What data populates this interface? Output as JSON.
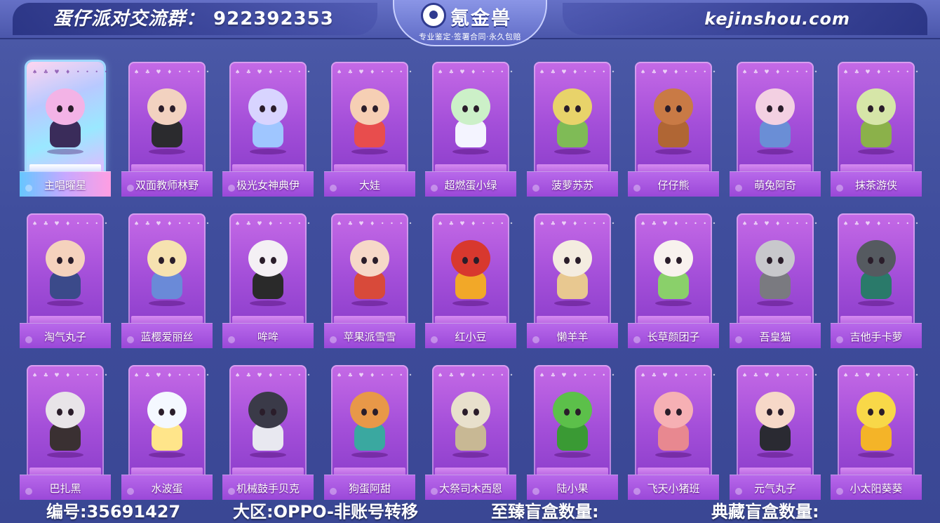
{
  "header": {
    "group_label": "蛋仔派对交流群：",
    "group_number": "922392353",
    "brand_name": "氪金兽",
    "brand_tagline": "专业鉴定·签署合同·永久包赔",
    "site_url": "kejinshou.com"
  },
  "suits_text": "♠ ♣ ♥ ♦ • • • •",
  "skins": [
    {
      "name": "主唱曜星",
      "special": true,
      "colors": [
        "#f3b3e6",
        "#3a2c5a"
      ]
    },
    {
      "name": "双面教师林野",
      "colors": [
        "#f2d2c0",
        "#2b2b2e"
      ]
    },
    {
      "name": "极光女神典伊",
      "colors": [
        "#d8d4ff",
        "#9fc6ff"
      ]
    },
    {
      "name": "大娃",
      "colors": [
        "#f6cfb4",
        "#e84d4d"
      ]
    },
    {
      "name": "超燃蛋小绿",
      "colors": [
        "#ccf0c8",
        "#f4f4ff"
      ]
    },
    {
      "name": "菠萝苏苏",
      "colors": [
        "#e8d36a",
        "#7fbb56"
      ]
    },
    {
      "name": "仔仔熊",
      "colors": [
        "#c97a45",
        "#b06634"
      ]
    },
    {
      "name": "萌兔阿奇",
      "colors": [
        "#f3d0e2",
        "#6a8ed6"
      ]
    },
    {
      "name": "抹茶游侠",
      "colors": [
        "#d6e6a8",
        "#8bb14a"
      ]
    },
    {
      "name": "淘气丸子",
      "colors": [
        "#f5d2bd",
        "#3b4a8a"
      ]
    },
    {
      "name": "蓝樱爱丽丝",
      "colors": [
        "#f6e2b0",
        "#6a8ad8"
      ]
    },
    {
      "name": "哞哞",
      "colors": [
        "#f4f0f4",
        "#2a2a2a"
      ]
    },
    {
      "name": "苹果派雪雪",
      "colors": [
        "#f6d8c8",
        "#d84a3a"
      ]
    },
    {
      "name": "红小豆",
      "colors": [
        "#d8382e",
        "#f2a828"
      ]
    },
    {
      "name": "懒羊羊",
      "colors": [
        "#f4ece0",
        "#e8c890"
      ]
    },
    {
      "name": "长草颜团子",
      "colors": [
        "#f8f2ee",
        "#8ad06a"
      ]
    },
    {
      "name": "吾皇猫",
      "colors": [
        "#c8c8cc",
        "#7a7a80"
      ]
    },
    {
      "name": "吉他手卡萝",
      "colors": [
        "#555a60",
        "#2a7a6a"
      ]
    },
    {
      "name": "巴扎黑",
      "colors": [
        "#e8e4e8",
        "#3a3032"
      ]
    },
    {
      "name": "水波蛋",
      "colors": [
        "#f4f8ff",
        "#ffe58a"
      ]
    },
    {
      "name": "机械鼓手贝克",
      "colors": [
        "#3a3a48",
        "#e8e8f0"
      ]
    },
    {
      "name": "狗蛋阿甜",
      "colors": [
        "#e89848",
        "#3aa8a0"
      ]
    },
    {
      "name": "大祭司木西恩",
      "colors": [
        "#e8e0cc",
        "#c8b894"
      ]
    },
    {
      "name": "陆小果",
      "colors": [
        "#5cc04a",
        "#3a9a34"
      ]
    },
    {
      "name": "飞天小猪班",
      "colors": [
        "#f6b0b4",
        "#e88890"
      ]
    },
    {
      "name": "元气丸子",
      "colors": [
        "#f6d8c8",
        "#2a2a32"
      ]
    },
    {
      "name": "小太阳葵葵",
      "colors": [
        "#f8d848",
        "#f4b428"
      ]
    }
  ],
  "footer": {
    "id_text": "编号:35691427",
    "region_text": "大区:OPPO-非账号转移",
    "zhizhen_text": "至臻盲盒数量:",
    "diancang_text": "典藏盲盒数量:"
  }
}
